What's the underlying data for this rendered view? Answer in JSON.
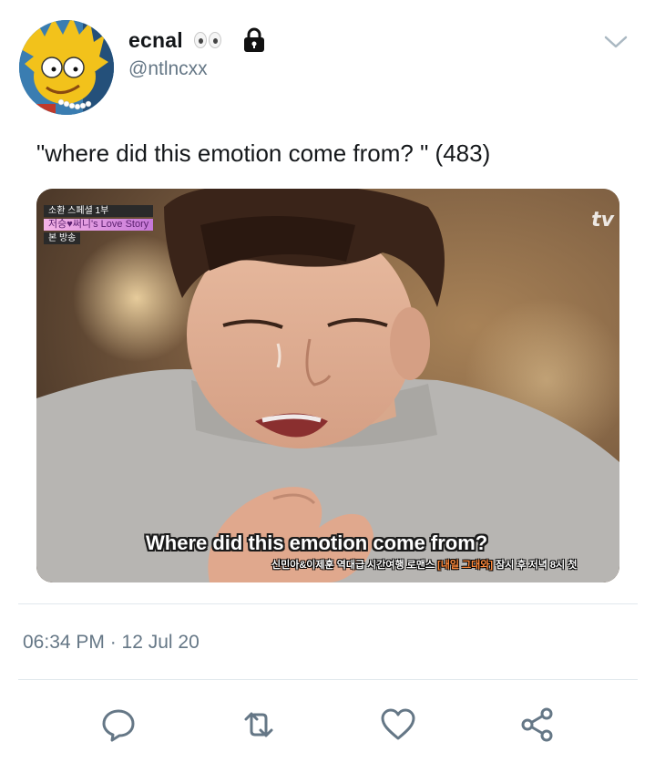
{
  "tweet": {
    "display_name": "ecnal",
    "name_emoji_icon": "eyes-icon",
    "protected_icon": "lock-icon",
    "handle": "@ntlncxx",
    "text": "\"where did this emotion come from? \" (483)",
    "timestamp": "06:34 PM · 12 Jul 20"
  },
  "media": {
    "badge_top": "소환 스페셜 1부",
    "badge_title": "저승♥써니's Love Story",
    "badge_bottom": "본 방송",
    "channel_logo": "tv",
    "subtitle": "Where did this emotion come from?",
    "ticker_prefix": "신민아&이제훈 역대급 시간여행 로맨스 ",
    "ticker_highlight": "[내일 그대와]",
    "ticker_suffix": " 잠시 후 저녁 8시 첫"
  },
  "actions": [
    {
      "name": "reply",
      "icon": "reply-icon"
    },
    {
      "name": "retweet",
      "icon": "retweet-icon"
    },
    {
      "name": "like",
      "icon": "heart-icon"
    },
    {
      "name": "share",
      "icon": "share-icon"
    }
  ],
  "colors": {
    "text_primary": "#14171a",
    "text_secondary": "#657786",
    "divider": "#e1e8ed",
    "icon": "#657786"
  }
}
